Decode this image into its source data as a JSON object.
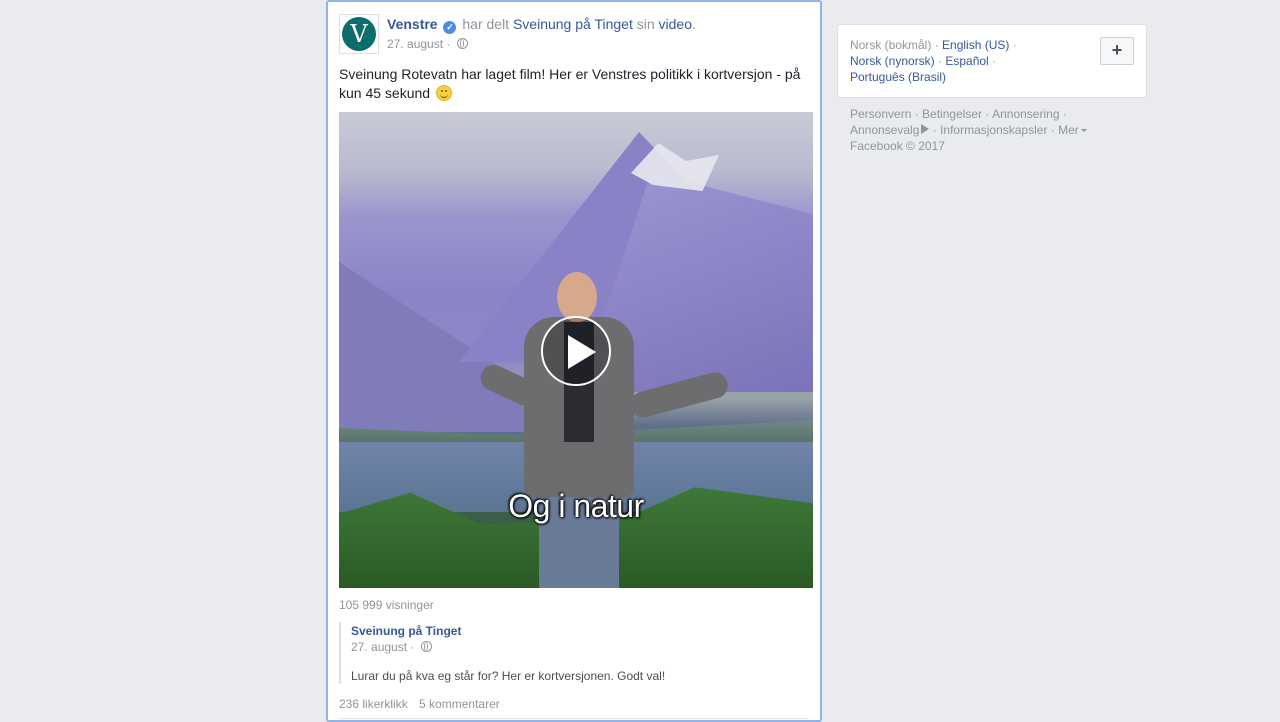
{
  "post": {
    "page_name": "Venstre",
    "avatar_letter": "V",
    "shared_text": "har delt",
    "shared_page": "Sveinung på Tinget",
    "possessive": "sin",
    "video_link": "video",
    "period": ".",
    "date": "27. august",
    "separator": " · ",
    "body": "Sveinung Rotevatn har laget film! Her er Venstres politikk i kortversjon - på kun 45 sekund",
    "video_caption": "Og i natur",
    "views": "105 999 visninger",
    "shared_post": {
      "name": "Sveinung på Tinget",
      "date": "27. august",
      "text": "Lurar du på kva eg står for? Her er kortversjonen. Godt val!"
    },
    "likes": "236 likerklikk",
    "comments": "5 kommentarer"
  },
  "sidebar": {
    "languages": {
      "current": "Norsk (bokmål)",
      "options": [
        "English (US)",
        "Norsk (nynorsk)",
        "Español",
        "Português (Brasil)"
      ],
      "add_label": "+"
    },
    "footer": {
      "links": [
        "Personvern",
        "Betingelser",
        "Annonsering",
        "Annonsevalg",
        "Informasjonskapsler",
        "Mer"
      ],
      "copyright": "Facebook © 2017"
    }
  },
  "colors": {
    "link": "#365899",
    "muted": "#90949c",
    "page_bg": "#e9ebee",
    "highlight_border": "#8fb3ea",
    "brand_green": "#0b6e6a"
  }
}
